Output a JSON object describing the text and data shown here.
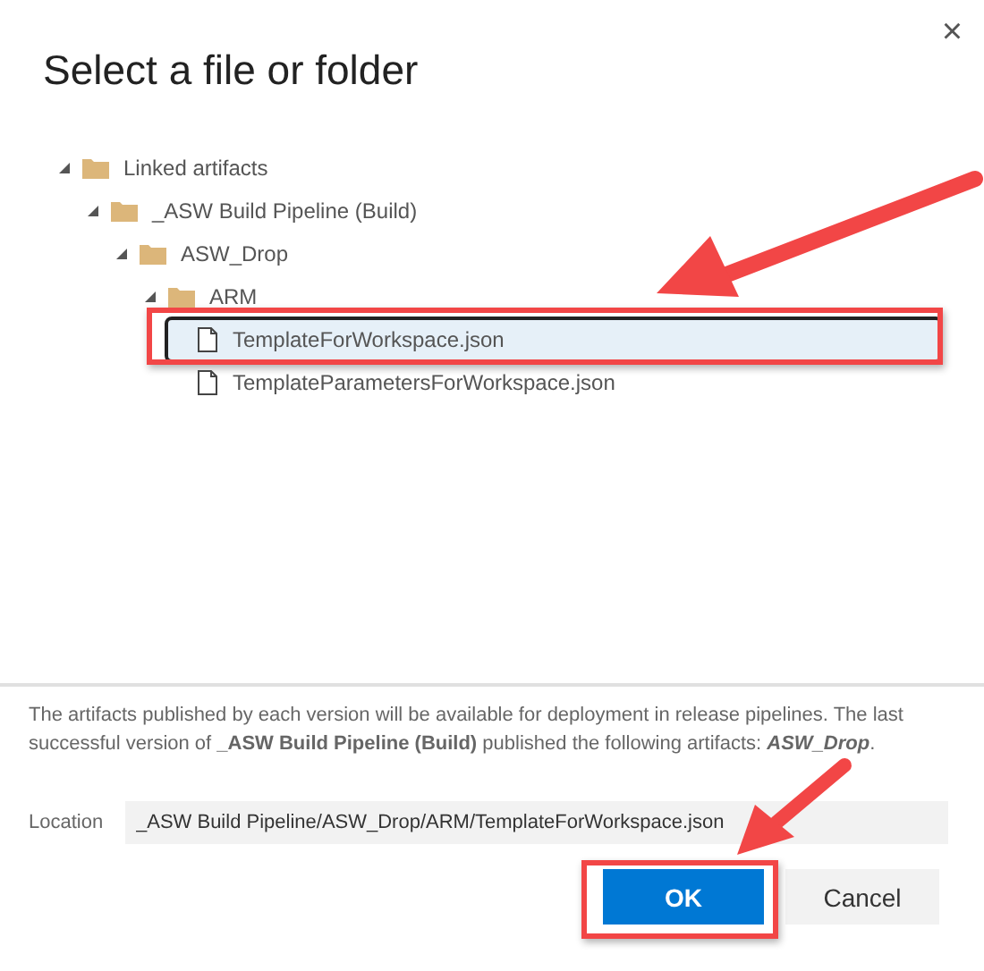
{
  "dialog": {
    "title": "Select a file or folder",
    "close_icon": "×"
  },
  "tree": [
    {
      "label": "Linked artifacts",
      "kind": "folder",
      "expanded": true,
      "selected": false,
      "children": [
        {
          "label": "_ASW Build Pipeline (Build)",
          "kind": "folder",
          "expanded": true,
          "selected": false,
          "children": [
            {
              "label": "ASW_Drop",
              "kind": "folder",
              "expanded": true,
              "selected": false,
              "children": [
                {
                  "label": "ARM",
                  "kind": "folder",
                  "expanded": true,
                  "selected": false,
                  "children": [
                    {
                      "label": "TemplateForWorkspace.json",
                      "kind": "file",
                      "selected": true
                    },
                    {
                      "label": "TemplateParametersForWorkspace.json",
                      "kind": "file",
                      "selected": false
                    }
                  ]
                }
              ]
            }
          ]
        }
      ]
    }
  ],
  "info": "The artifacts published by each version will be available for deployment in release pipelines. The last successful version of **_ASW Build Pipeline (Build)** published the following artifacts: *ASW_Drop*.",
  "location": {
    "label": "Location",
    "value": "_ASW Build Pipeline/ASW_Drop/ARM/TemplateForWorkspace.json"
  },
  "buttons": [
    {
      "label": "OK",
      "kind": "primary"
    },
    {
      "label": "Cancel",
      "kind": "secondary"
    }
  ]
}
